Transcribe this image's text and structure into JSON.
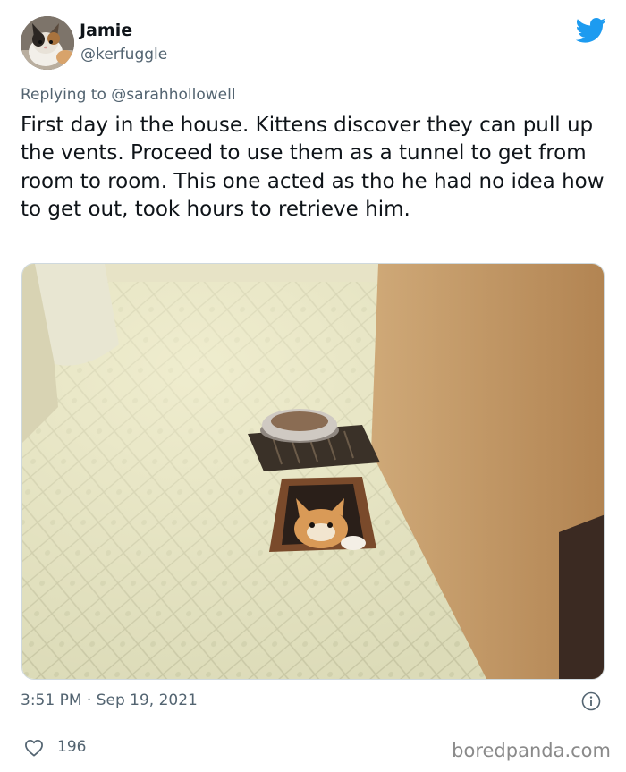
{
  "author": {
    "name": "Jamie",
    "handle": "@kerfuggle"
  },
  "reply": {
    "prefix": "Replying to ",
    "mention": "@sarahhollowell"
  },
  "tweet": {
    "text": "First day in the house. Kittens discover they can pull up the vents. Proceed to use them as a tunnel to get from room to room. This one acted as tho he had no idea how to get out, took hours to retrieve him."
  },
  "meta": {
    "timestamp": "3:51 PM · Sep 19, 2021",
    "likes": "196"
  },
  "watermark": "boredpanda.com",
  "colors": {
    "twitter_blue": "#1d9bf0",
    "secondary_text": "#536471"
  },
  "icons": {
    "brand": "twitter-bird-icon",
    "info": "info-icon",
    "like": "heart-icon"
  }
}
